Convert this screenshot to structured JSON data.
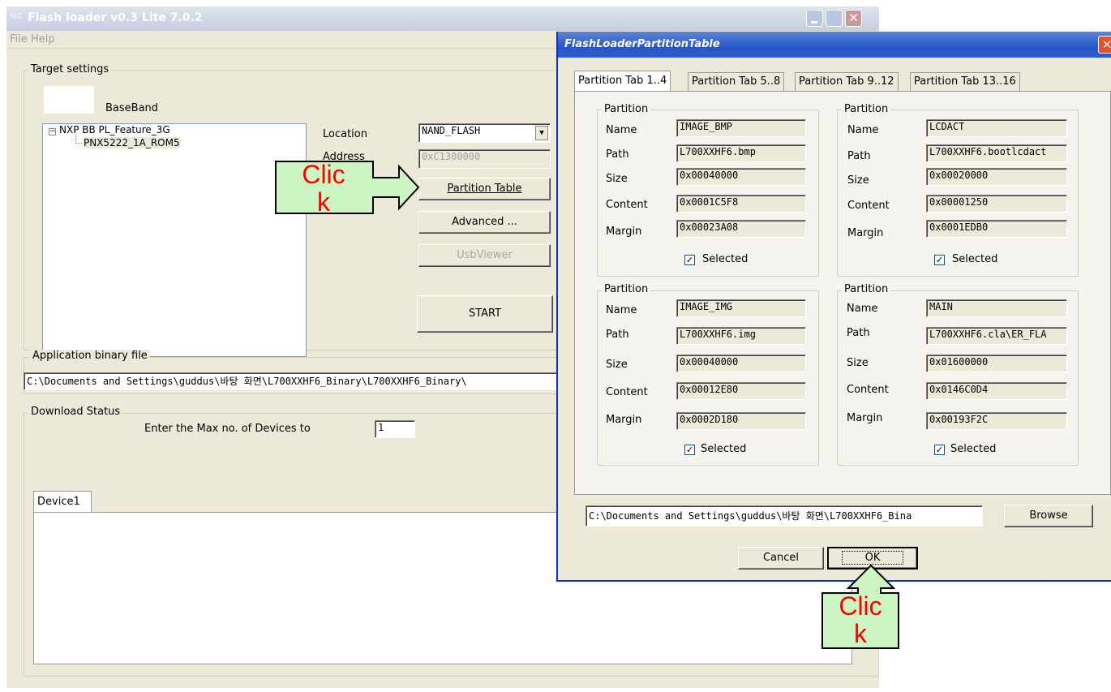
{
  "main_window": {
    "title": "Flash loader v0.3 Lite 7.0.2",
    "menu": [
      "File",
      "Help"
    ],
    "target_settings": {
      "group_label": "Target settings",
      "baseband_label": "BaseBand",
      "tree": {
        "root": "NXP BB PL_Feature_3G",
        "child": "PNX5222_1A_ROM5"
      },
      "location_label": "Location",
      "location_value": "NAND_FLASH",
      "address_label": "Address",
      "address_value": "0xC1300000",
      "partition_table_button": "Partition Table",
      "advanced_button": "Advanced ...",
      "usbviewer_button": "UsbViewer",
      "start_button": "START"
    },
    "app_binary": {
      "group_label": "Application binary file",
      "path": "C:\\Documents and Settings\\guddus\\바탕 화면\\L700XXHF6_Binary\\L700XXHF6_Binary\\"
    },
    "download_status": {
      "group_label": "Download Status",
      "max_devices_label": "Enter the Max no. of Devices to",
      "max_devices_value": "1",
      "device_tab": "Device1"
    }
  },
  "dialog": {
    "title": "FlashLoaderPartitionTable",
    "tabs": [
      "Partition Tab 1..4",
      "Partition Tab 5..8",
      "Partition Tab 9..12",
      "Partition Tab 13..16"
    ],
    "partition_group_label": "Partition",
    "field_labels": {
      "name": "Name",
      "path": "Path",
      "size": "Size",
      "content": "Content",
      "margin": "Margin"
    },
    "selected_label": "Selected",
    "partitions": [
      {
        "name": "IMAGE_BMP",
        "path": "L700XXHF6.bmp",
        "size": "0x00040000",
        "content": "0x0001C5F8",
        "margin": "0x00023A08",
        "selected": true
      },
      {
        "name": "LCDACT",
        "path": "L700XXHF6.bootlcdact",
        "size": "0x00020000",
        "content": "0x00001250",
        "margin": "0x0001EDB0",
        "selected": true
      },
      {
        "name": "IMAGE_IMG",
        "path": "L700XXHF6.img",
        "size": "0x00040000",
        "content": "0x00012E80",
        "margin": "0x0002D180",
        "selected": true
      },
      {
        "name": "MAIN",
        "path": "L700XXHF6.cla\\ER_FLA",
        "size": "0x01600000",
        "content": "0x0146C0D4",
        "margin": "0x00193F2C",
        "selected": true
      }
    ],
    "file_path": "C:\\Documents and Settings\\guddus\\바탕 화면\\L700XXHF6_Bina",
    "browse_button": "Browse",
    "cancel_button": "Cancel",
    "ok_button": "OK"
  },
  "annotations": {
    "click_label_1": "Clic",
    "click_label_2": "k"
  },
  "colors": {
    "window_bg": "#ece9d8",
    "callout_fill": "#cdf5c3",
    "callout_text": "#ff0000"
  }
}
